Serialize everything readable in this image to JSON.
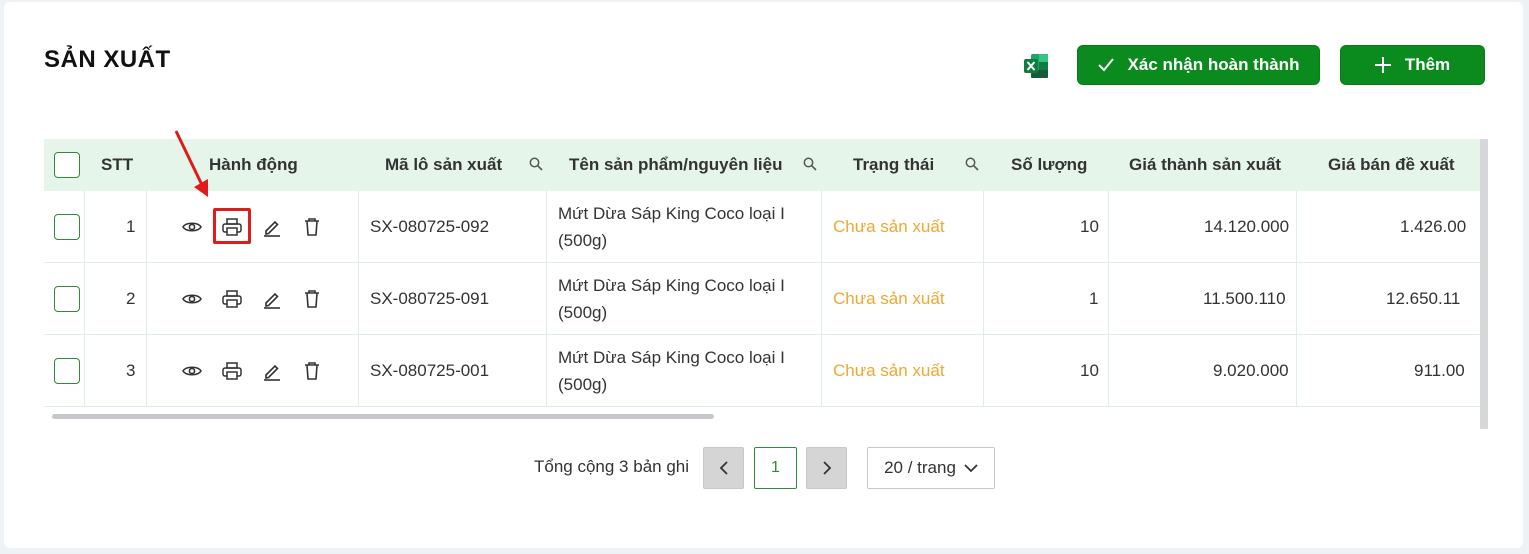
{
  "page": {
    "title": "SẢN XUẤT"
  },
  "toolbar": {
    "confirm_label": "Xác nhận hoàn thành",
    "add_label": "Thêm",
    "excel_icon": "excel-icon",
    "accent_color": "#0b8a1e"
  },
  "table": {
    "headers": {
      "stt": "STT",
      "actions": "Hành động",
      "batch_code": "Mã lô sản xuất",
      "product_name": "Tên sản phẩm/nguyên liệu",
      "status": "Trạng thái",
      "quantity": "Số lượng",
      "cost": "Giá thành sản xuất",
      "suggested_price": "Giá bán đề xuất"
    },
    "rows": [
      {
        "stt": "1",
        "batch_code": "SX-080725-092",
        "product_line1": "Mứt Dừa Sáp King Coco loại I",
        "product_line2": "(500g)",
        "status": "Chưa sản xuất",
        "quantity": "10",
        "cost": "14.120.000",
        "suggested_price": "1.426.00"
      },
      {
        "stt": "2",
        "batch_code": "SX-080725-091",
        "product_line1": "Mứt Dừa Sáp King Coco loại I",
        "product_line2": "(500g)",
        "status": "Chưa sản xuất",
        "quantity": "1",
        "cost": "11.500.110",
        "suggested_price": "12.650.11"
      },
      {
        "stt": "3",
        "batch_code": "SX-080725-001",
        "product_line1": "Mứt Dừa Sáp King Coco loại I",
        "product_line2": "(500g)",
        "status": "Chưa sản xuất",
        "quantity": "10",
        "cost": "9.020.000",
        "suggested_price": "911.00"
      }
    ],
    "status_color": "#f0a830"
  },
  "pagination": {
    "total_text": "Tổng cộng 3 bản ghi",
    "current_page": "1",
    "page_size": "20 / trang"
  }
}
